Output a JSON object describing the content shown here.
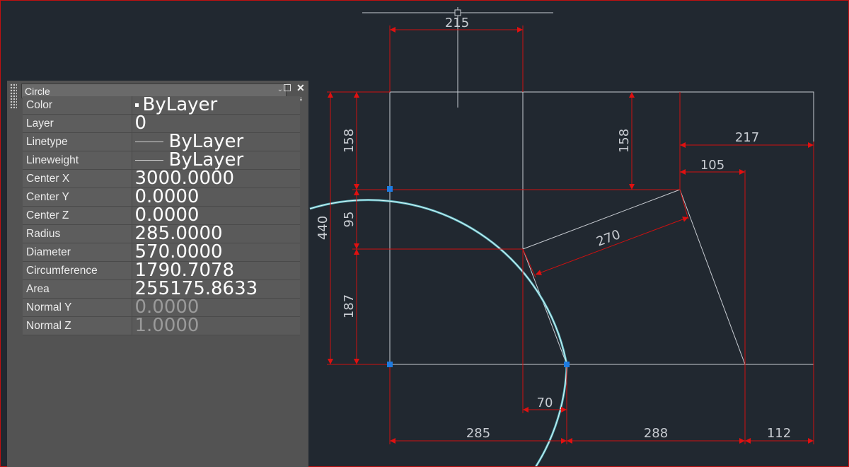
{
  "properties_panel": {
    "object_type": "Circle",
    "rows": [
      {
        "key": "Color",
        "value": "ByLayer",
        "kind": "swatch"
      },
      {
        "key": "Layer",
        "value": "0",
        "kind": "text"
      },
      {
        "key": "Linetype",
        "value": "ByLayer",
        "kind": "line"
      },
      {
        "key": "Lineweight",
        "value": "ByLayer",
        "kind": "line"
      },
      {
        "key": "Center X",
        "value": "3000.0000",
        "kind": "text"
      },
      {
        "key": "Center Y",
        "value": "0.0000",
        "kind": "text"
      },
      {
        "key": "Center Z",
        "value": "0.0000",
        "kind": "text"
      },
      {
        "key": "Radius",
        "value": "285.0000",
        "kind": "text"
      },
      {
        "key": "Diameter",
        "value": "570.0000",
        "kind": "text"
      },
      {
        "key": "Circumference",
        "value": "1790.7078",
        "kind": "text"
      },
      {
        "key": "Area",
        "value": "255175.8633",
        "kind": "text"
      },
      {
        "key": "Normal Y",
        "value": "0.0000",
        "kind": "readonly"
      },
      {
        "key": "Normal Z",
        "value": "1.0000",
        "kind": "readonly"
      }
    ]
  },
  "drawing": {
    "dimensions": {
      "top_width": "215",
      "left_total": "440",
      "left_upper": "158",
      "left_middle": "95",
      "left_lower": "187",
      "inner_height": "158",
      "right_width": "217",
      "right_inner_width": "105",
      "slanted_length": "270",
      "offset_small": "70",
      "bottom_left": "285",
      "bottom_mid": "288",
      "bottom_right": "112"
    },
    "colors": {
      "background": "#212830",
      "dimension": "#e01010",
      "geometry": "#c8ccd2",
      "circle": "#8ee0e8",
      "grip": "#1e7be0"
    }
  }
}
